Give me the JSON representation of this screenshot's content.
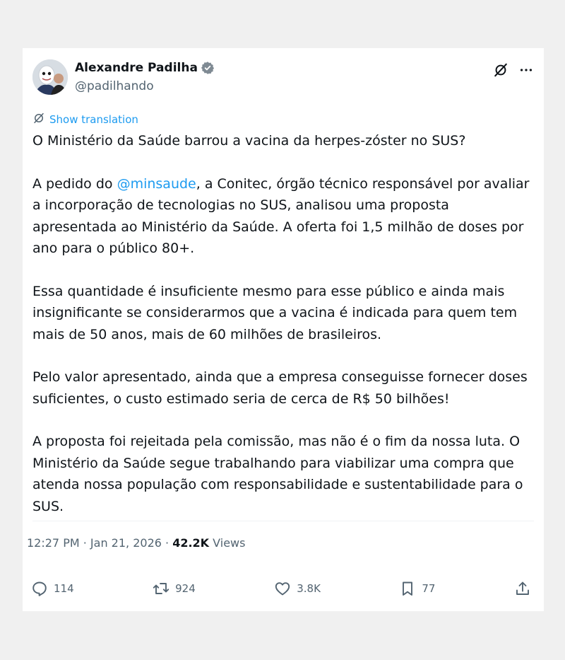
{
  "author": {
    "name": "Alexandre Padilha",
    "handle": "@padilhando"
  },
  "translate_label": "Show translation",
  "tweet": {
    "p1": "O Ministério da Saúde barrou a vacina da herpes-zóster no SUS?",
    "p2_before": "A pedido do ",
    "p2_mention": "@minsaude",
    "p2_after": ", a Conitec, órgão técnico responsável por avaliar a incorporação de tecnologias no SUS, analisou uma proposta apresentada ao Ministério da Saúde. A oferta foi 1,5 milhão de doses por ano para o público 80+.",
    "p3": "Essa quantidade é insuficiente mesmo para esse público e ainda mais insignificante se considerarmos que a vacina é indicada para quem tem mais de 50 anos, mais de 60 milhões de brasileiros.",
    "p4": "Pelo valor apresentado, ainda que a empresa conseguisse fornecer doses suficientes, o custo estimado seria de cerca de R$ 50 bilhões!",
    "p5": "A proposta foi rejeitada pela comissão, mas não é o fim da nossa luta. O Ministério da Saúde segue trabalhando para viabilizar uma compra que atenda nossa população com responsabilidade e sustentabilidade para o SUS."
  },
  "meta": {
    "time": "12:27 PM",
    "date": "Jan 21, 2026",
    "views_count": "42.2K",
    "views_label": "Views"
  },
  "actions": {
    "replies": "114",
    "reposts": "924",
    "likes": "3.8K",
    "bookmarks": "77"
  },
  "colors": {
    "accent": "#1d9bf0",
    "muted": "#536471",
    "text": "#0f1419"
  },
  "icons": [
    "verified-badge-icon",
    "grok-icon",
    "more-icon",
    "translate-icon",
    "reply-icon",
    "repost-icon",
    "like-icon",
    "bookmark-icon",
    "share-icon"
  ]
}
